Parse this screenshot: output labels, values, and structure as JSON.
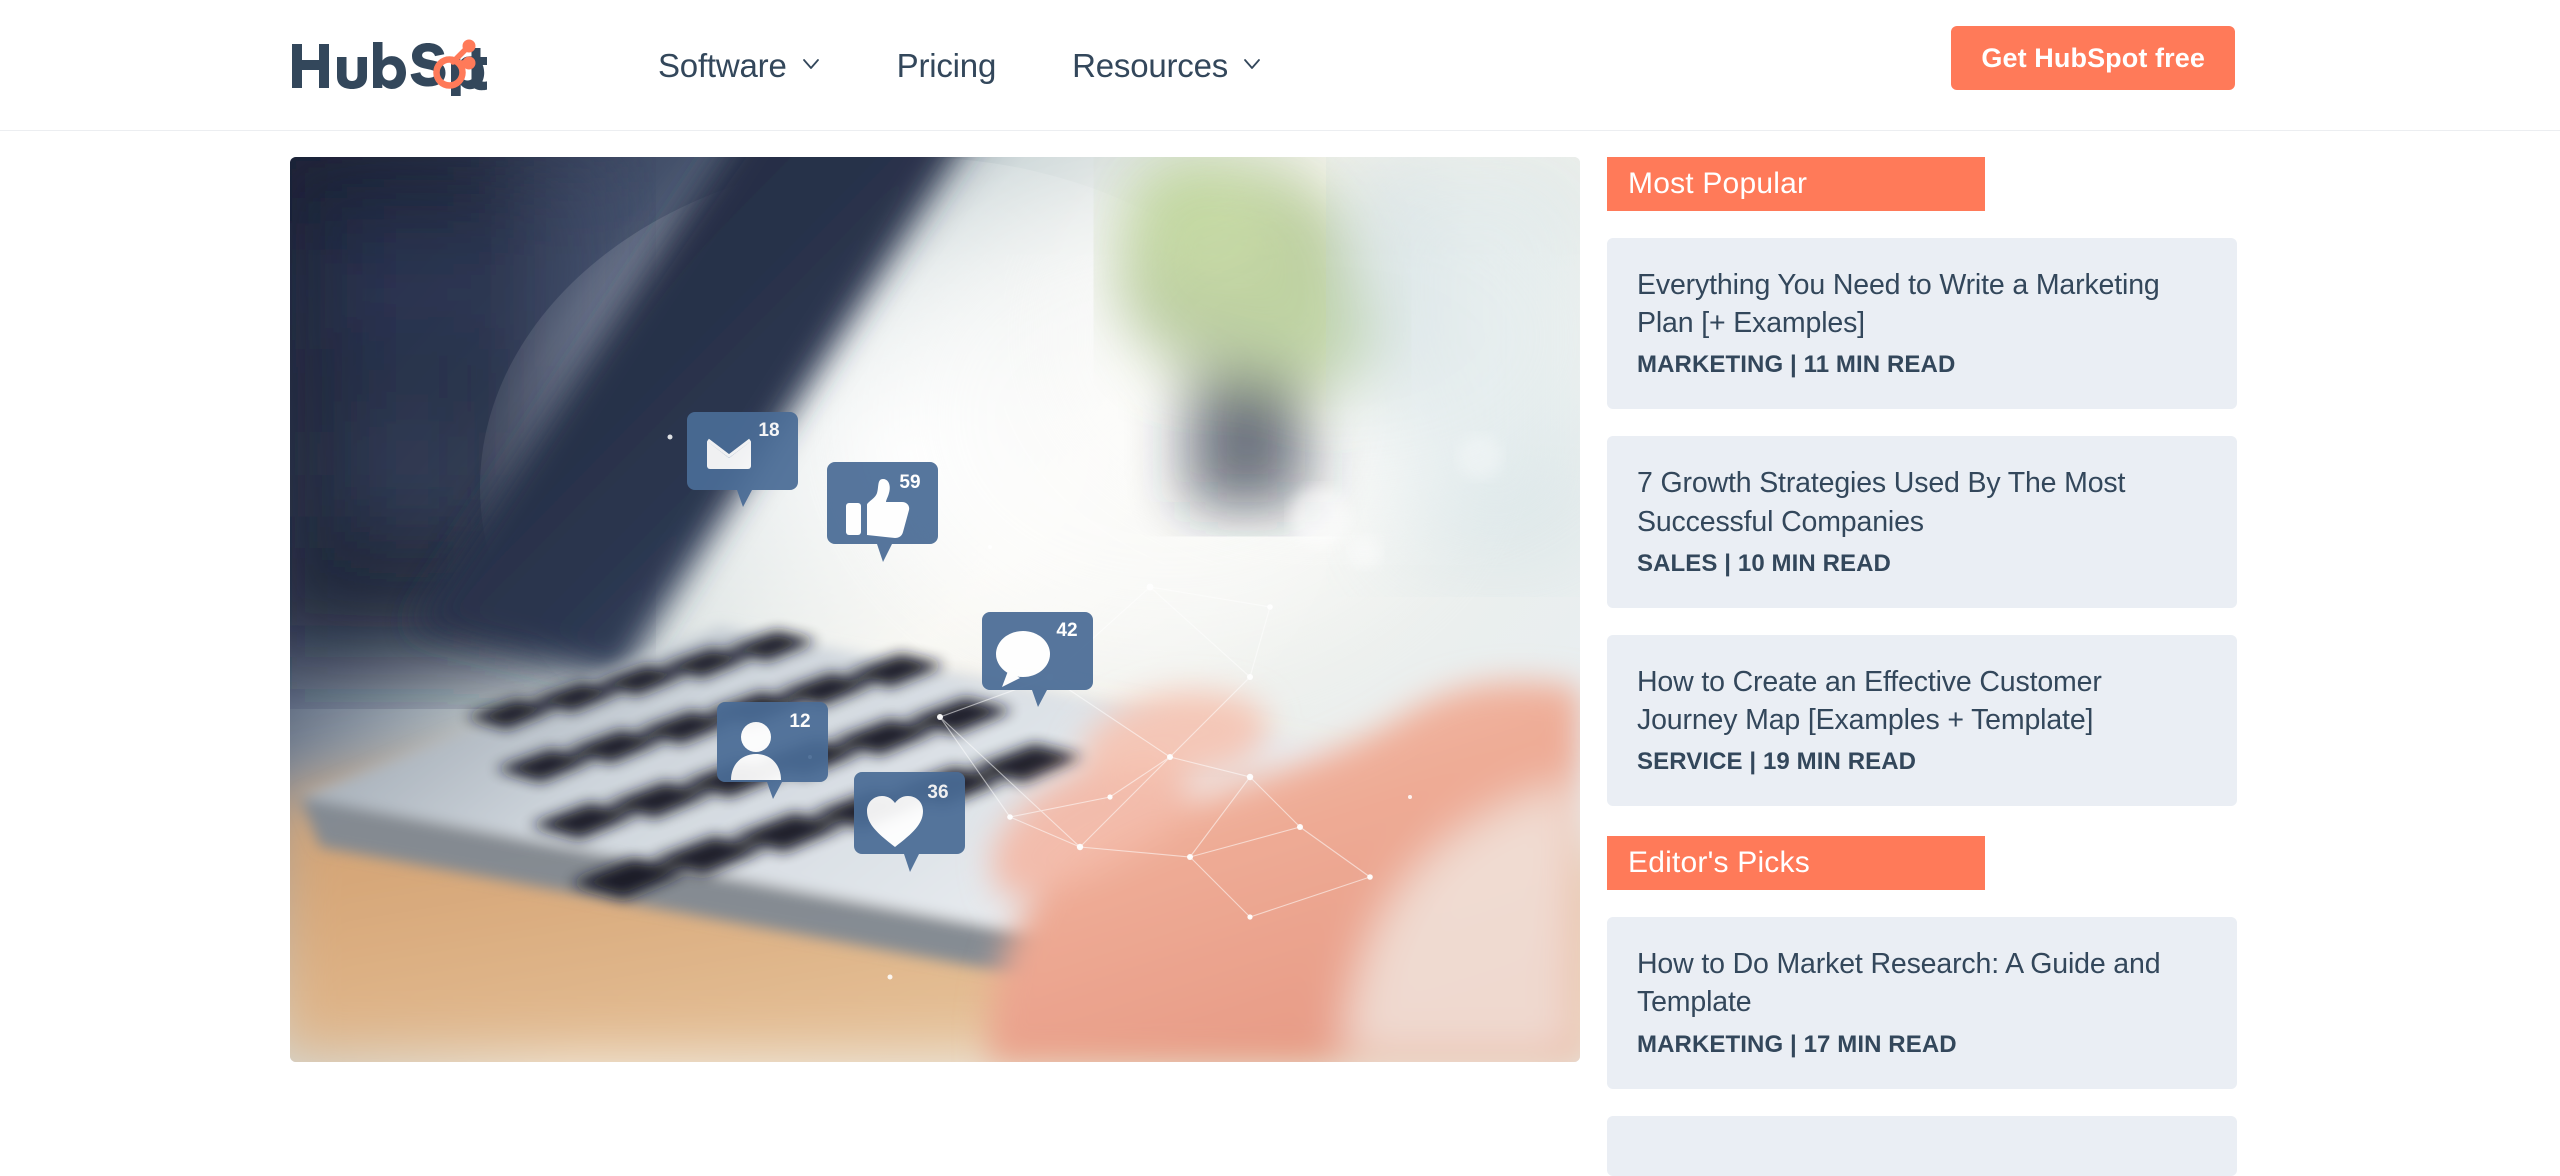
{
  "header": {
    "logo_alt": "HubSpot",
    "nav_items": [
      {
        "label": "Software",
        "has_dropdown": true
      },
      {
        "label": "Pricing",
        "has_dropdown": false
      },
      {
        "label": "Resources",
        "has_dropdown": true
      }
    ],
    "cta_label": "Get HubSpot free",
    "accent_color": "#ff7a59",
    "text_color": "#33475b"
  },
  "hero": {
    "alt": "Hands typing on a laptop keyboard with floating social media notification badges",
    "badges": [
      {
        "icon": "envelope-icon",
        "count": "18"
      },
      {
        "icon": "thumbs-up-icon",
        "count": "59"
      },
      {
        "icon": "comment-bubble-icon",
        "count": "42"
      },
      {
        "icon": "person-icon",
        "count": "12"
      },
      {
        "icon": "heart-icon",
        "count": "36"
      }
    ]
  },
  "sidebar": {
    "sections": [
      {
        "title": "Most Popular",
        "cards": [
          {
            "title": "Everything You Need to Write a Marketing Plan [+ Examples]",
            "meta": "MARKETING | 11 MIN READ"
          },
          {
            "title": "7 Growth Strategies Used By The Most Successful Companies",
            "meta": "SALES | 10 MIN READ"
          },
          {
            "title": "How to Create an Effective Customer Journey Map [Examples + Template]",
            "meta": "SERVICE | 19 MIN READ"
          }
        ]
      },
      {
        "title": "Editor's Picks",
        "cards": [
          {
            "title": "How to Do Market Research: A Guide and Template",
            "meta": "MARKETING | 17 MIN READ"
          }
        ]
      }
    ],
    "card_bg": "#eaeef4",
    "banner_bg": "#ff7a59"
  }
}
